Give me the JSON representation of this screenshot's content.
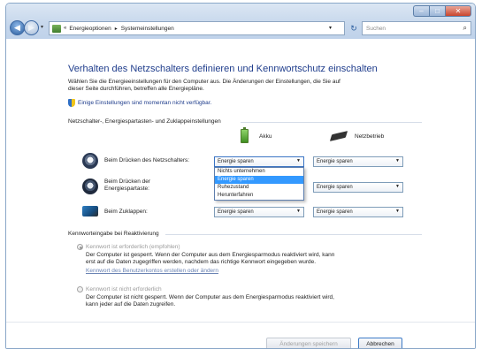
{
  "window": {
    "address": {
      "crumbs": [
        "Energieoptionen",
        "Systemeinstellungen"
      ],
      "separator": "▸"
    },
    "search_placeholder": "Suchen"
  },
  "page": {
    "title": "Verhalten des Netzschalters definieren und Kennwortschutz einschalten",
    "intro_line1": "Wählen Sie die Energieeinstellungen für den Computer aus. Die Änderungen der Einstellungen, die Sie auf",
    "intro_line2": "dieser Seite durchführen, betreffen alle Energiepläne.",
    "info_link": "Einige Einstellungen sind momentan nicht verfügbar."
  },
  "power_section": {
    "heading": "Netzschalter-, Energiespartasten- und Zuklappeinstellungen",
    "col_battery": "Akku",
    "col_ac": "Netzbetrieb",
    "rows": [
      {
        "label_line1": "Beim Drücken des Netzschalters:",
        "label_line2": "",
        "battery": "Energie sparen",
        "ac": "Energie sparen"
      },
      {
        "label_line1": "Beim Drücken der",
        "label_line2": "Energiespartaste:",
        "battery": "",
        "ac": "Energie sparen"
      },
      {
        "label_line1": "Beim Zuklappen:",
        "label_line2": "",
        "battery": "Energie sparen",
        "ac": "Energie sparen"
      }
    ],
    "dropdown_options": [
      "Nichts unternehmen",
      "Energie sparen",
      "Ruhezustand",
      "Herunterfahren"
    ],
    "dropdown_selected_index": 1
  },
  "password_section": {
    "heading": "Kennworteingabe bei Reaktivierung",
    "option_required": {
      "label": "Kennwort ist erforderlich (empfohlen)",
      "desc_line1": "Der Computer ist gesperrt. Wenn der Computer aus dem Energiesparmodus reaktiviert wird, kann",
      "desc_line2": "erst auf die Daten zugegriffen werden, nachdem das richtige Kennwort eingegeben wurde.",
      "link": "Kennwort des Benutzerkontos erstellen oder ändern"
    },
    "option_not_required": {
      "label": "Kennwort ist nicht erforderlich",
      "desc_line1": "Der Computer ist nicht gesperrt. Wenn der Computer aus dem Energiesparmodus reaktiviert wird,",
      "desc_line2": "kann jeder auf die Daten zugreifen."
    }
  },
  "buttons": {
    "save": "Änderungen speichern",
    "cancel": "Abbrechen"
  },
  "colors": {
    "title_blue": "#1f3d8c",
    "selection": "#3399ff"
  }
}
